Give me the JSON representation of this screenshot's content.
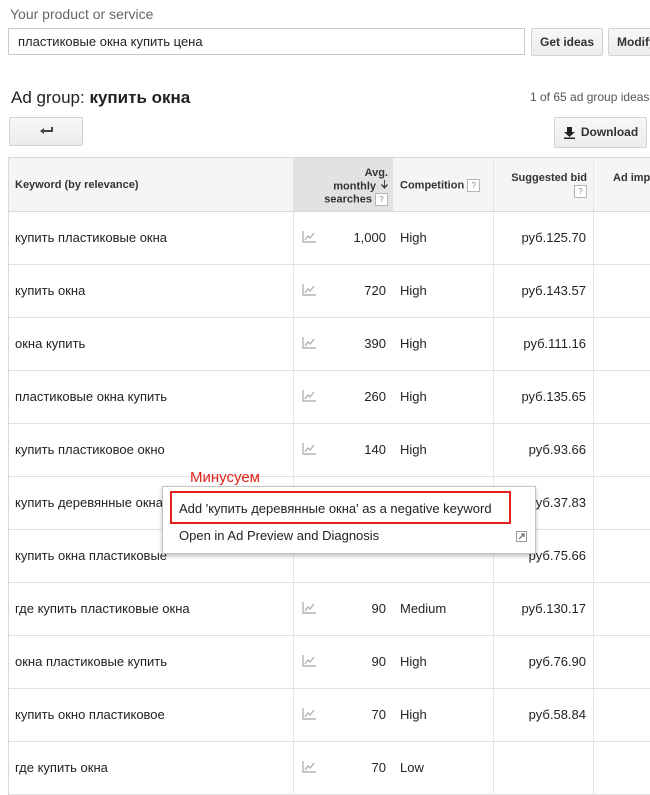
{
  "header": {
    "product_label": "Your product or service",
    "search_value": "пластиковые окна купить цена",
    "get_ideas_label": "Get ideas",
    "modify_label": "Modify"
  },
  "adgroup": {
    "prefix": "Ad group: ",
    "name": "купить окна",
    "pager": "1 of 65 ad group ideas",
    "download_label": "Download"
  },
  "table": {
    "headers": {
      "keyword": "Keyword (by relevance)",
      "volume_line1": "Avg.",
      "volume_line2": "monthly",
      "volume_line3": "searches",
      "competition": "Competition",
      "bid_line1": "Suggested bid",
      "ad_impr": "Ad impr"
    },
    "help_glyph": "?",
    "rows": [
      {
        "keyword": "купить пластиковые окна",
        "volume": "1,000",
        "competition": "High",
        "bid": "руб.125.70"
      },
      {
        "keyword": "купить окна",
        "volume": "720",
        "competition": "High",
        "bid": "руб.143.57"
      },
      {
        "keyword": "окна купить",
        "volume": "390",
        "competition": "High",
        "bid": "руб.111.16"
      },
      {
        "keyword": "пластиковые окна купить",
        "volume": "260",
        "competition": "High",
        "bid": "руб.135.65"
      },
      {
        "keyword": "купить пластиковое окно",
        "volume": "140",
        "competition": "High",
        "bid": "руб.93.66"
      },
      {
        "keyword": "купить деревянные окна",
        "volume": "",
        "competition": "",
        "bid": "руб.37.83"
      },
      {
        "keyword": "купить окна пластиковые",
        "volume": "",
        "competition": "",
        "bid": "руб.75.66"
      },
      {
        "keyword": "где купить пластиковые окна",
        "volume": "90",
        "competition": "Medium",
        "bid": "руб.130.17"
      },
      {
        "keyword": "окна пластиковые купить",
        "volume": "90",
        "competition": "High",
        "bid": "руб.76.90"
      },
      {
        "keyword": "купить окно пластиковое",
        "volume": "70",
        "competition": "High",
        "bid": "руб.58.84"
      },
      {
        "keyword": "где купить окна",
        "volume": "70",
        "competition": "Low",
        "bid": ""
      }
    ]
  },
  "context_menu": {
    "add_negative": "Add 'купить деревянные окна' as a negative keyword",
    "open_preview": "Open in Ad Preview and Diagnosis"
  },
  "annotation": {
    "label": "Минусуем",
    "color": "#e32219"
  },
  "icons": [
    "back-arrow-icon",
    "download-icon",
    "sort-down-icon",
    "trend-chart-icon",
    "external-link-icon"
  ]
}
